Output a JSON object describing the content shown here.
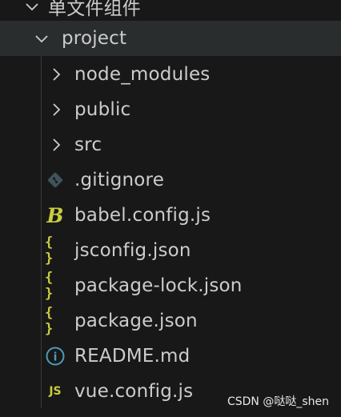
{
  "explorer": {
    "workspace_label": "单文件组件",
    "project_label": "project",
    "items": [
      {
        "label": "node_modules",
        "kind": "folder",
        "icon": "chevron-right-icon"
      },
      {
        "label": "public",
        "kind": "folder",
        "icon": "chevron-right-icon"
      },
      {
        "label": "src",
        "kind": "folder",
        "icon": "chevron-right-icon"
      },
      {
        "label": ".gitignore",
        "kind": "file",
        "icon": "git-icon"
      },
      {
        "label": "babel.config.js",
        "kind": "file",
        "icon": "babel-icon"
      },
      {
        "label": "jsconfig.json",
        "kind": "file",
        "icon": "json-icon"
      },
      {
        "label": "package-lock.json",
        "kind": "file",
        "icon": "json-icon"
      },
      {
        "label": "package.json",
        "kind": "file",
        "icon": "json-icon"
      },
      {
        "label": "README.md",
        "kind": "file",
        "icon": "info-icon"
      },
      {
        "label": "vue.config.js",
        "kind": "file",
        "icon": "javascript-icon"
      }
    ]
  },
  "icons": {
    "json_glyph": "{ }",
    "js_glyph": "JS",
    "babel_glyph": "B",
    "info_glyph": "i"
  },
  "watermark": "CSDN @哒哒_shen",
  "colors": {
    "background": "#181818",
    "selected_row": "#2a2d2e",
    "text": "#cccccc",
    "json_icon": "#cbcb41",
    "info_icon": "#519aba",
    "git_icon": "#41535b"
  }
}
